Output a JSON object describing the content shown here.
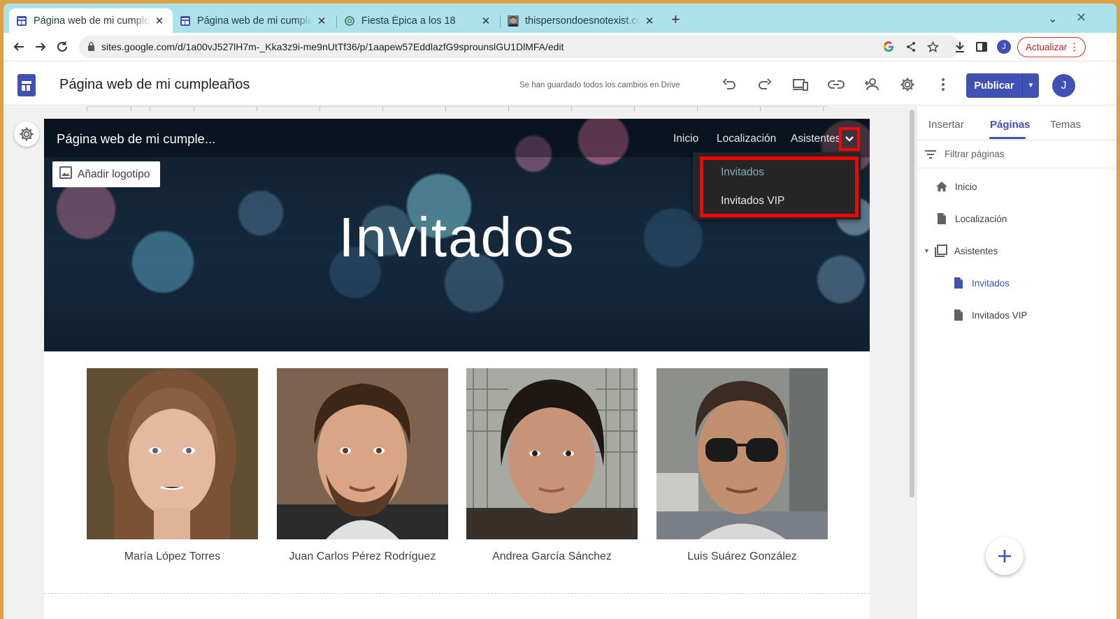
{
  "browser": {
    "tabs": [
      {
        "title": "Página web de mi cumpleaños",
        "icon": "google-sites-icon",
        "close": "✕"
      },
      {
        "title": "Página web de mi cumpleaños",
        "icon": "google-sites-icon",
        "close": "✕"
      },
      {
        "title": "Fiesta Épica a los 18",
        "icon": "chatgpt-icon",
        "close": "✕"
      },
      {
        "title": "thispersondoesnotexist.com",
        "icon": "person-face-icon",
        "close": "✕"
      }
    ],
    "new_tab": "+",
    "url": "sites.google.com/d/1a00vJ527lH7m-_Kka3z9i-me9nUtTf36/p/1aapew57EddlazfG9sprounslGU1DlMFA/edit",
    "profile_initial": "J",
    "update_label": "Actualizar"
  },
  "app": {
    "doc_title": "Página web de mi cumpleaños",
    "saved_status": "Se han guardado todos los cambios en Drive",
    "publish_label": "Publicar",
    "user_initial": "J"
  },
  "site": {
    "name": "Página web de mi cumple...",
    "nav": [
      "Inicio",
      "Localización",
      "Asistentes"
    ],
    "add_logo_label": "Añadir logotipo",
    "hero_title": "Invitados",
    "dropdown": [
      {
        "label": "Invitados",
        "color": "#7eb0c8"
      },
      {
        "label": "Invitados VIP",
        "color": "#e8e8e8"
      }
    ],
    "people": [
      {
        "name": "María López Torres"
      },
      {
        "name": "Juan Carlos Pérez Rodríguez"
      },
      {
        "name": "Andrea García Sánchez"
      },
      {
        "name": "Luis Suárez González"
      }
    ]
  },
  "panel": {
    "tabs": [
      "Insertar",
      "Páginas",
      "Temas"
    ],
    "active_tab": "Páginas",
    "filter_placeholder": "Filtrar páginas",
    "pages": [
      {
        "label": "Inicio",
        "icon": "home-icon"
      },
      {
        "label": "Localización",
        "icon": "page-icon"
      },
      {
        "label": "Asistentes",
        "icon": "page-collection-icon"
      },
      {
        "label": "Invitados",
        "icon": "page-icon"
      },
      {
        "label": "Invitados VIP",
        "icon": "page-icon"
      }
    ],
    "fab_label": "+"
  },
  "colors": {
    "accent": "#3f51b5",
    "highlight": "#ff0000",
    "tabstrip": "#ade2ea"
  }
}
